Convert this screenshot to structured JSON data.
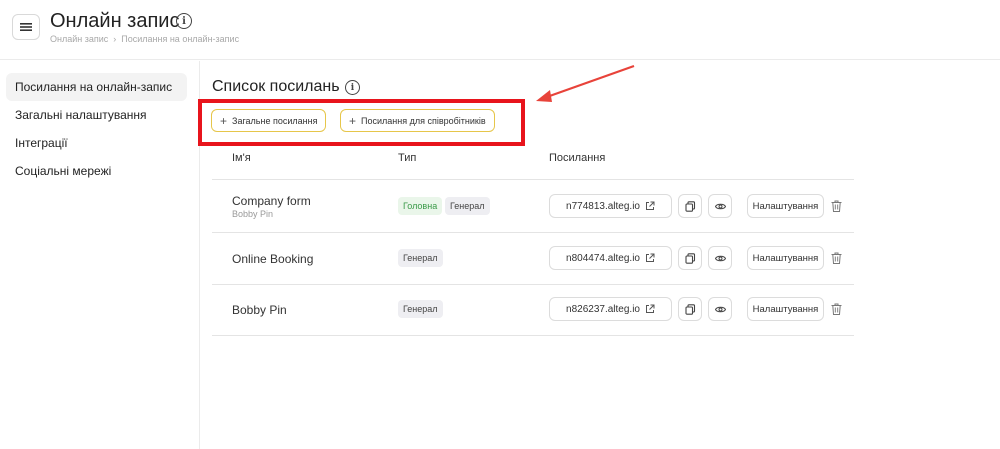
{
  "header": {
    "title": "Онлайн запис",
    "info_icon": "info-icon",
    "breadcrumb": [
      "Онлайн запис",
      "Посилання на онлайн-запис"
    ]
  },
  "sidebar": {
    "items": [
      {
        "label": "Посилання на онлайн-запис",
        "active": true
      },
      {
        "label": "Загальні налаштування",
        "active": false
      },
      {
        "label": "Інтеграції",
        "active": false
      },
      {
        "label": "Соціальні мережі",
        "active": false
      }
    ]
  },
  "main": {
    "title": "Список посилань",
    "buttons": {
      "general_link": "Загальне посилання",
      "employee_link": "Посилання для співробітників"
    },
    "columns": [
      "Ім'я",
      "Тип",
      "Посилання"
    ],
    "rows": [
      {
        "name": "Company form",
        "sub": "Bobby Pin",
        "tags": [
          "Головна",
          "Генерал"
        ],
        "link": "n774813.alteg.io",
        "settings": "Налаштування"
      },
      {
        "name": "Online Booking",
        "sub": "",
        "tags": [
          "Генерал"
        ],
        "link": "n804474.alteg.io",
        "settings": "Налаштування"
      },
      {
        "name": "Bobby Pin",
        "sub": "",
        "tags": [
          "Генерал"
        ],
        "link": "n826237.alteg.io",
        "settings": "Налаштування"
      }
    ]
  },
  "colors": {
    "accent_border": "#e6c64a",
    "highlight": "#e8141c",
    "tag_main": "#3a9a48"
  }
}
